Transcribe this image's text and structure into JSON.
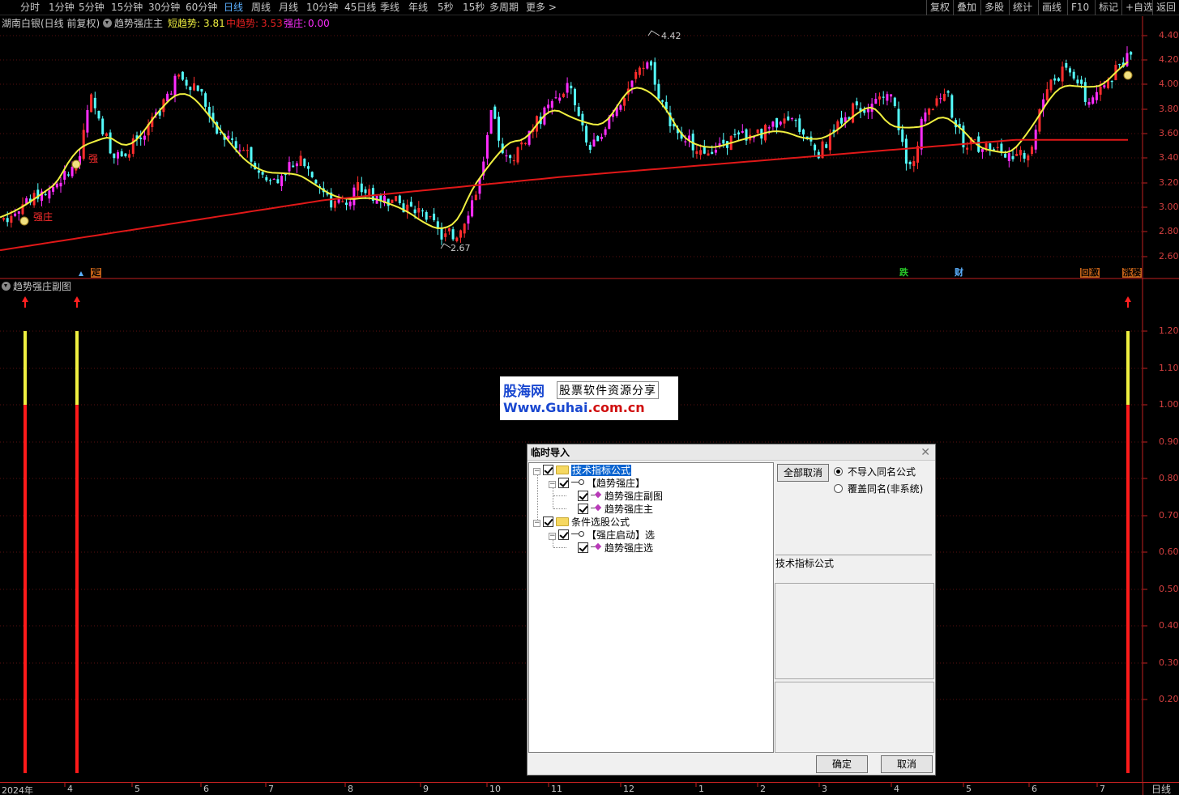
{
  "toolbar": {
    "periods": [
      "分时",
      "1分钟",
      "5分钟",
      "15分钟",
      "30分钟",
      "60分钟",
      "日线",
      "周线",
      "月线",
      "10分钟",
      "45日线",
      "季线",
      "年线",
      "5秒",
      "15秒",
      "多周期",
      "更多 >"
    ],
    "active_period": "日线",
    "right_buttons": [
      "复权",
      "叠加",
      "多股",
      "统计",
      "画线",
      "F10",
      "标记",
      "+自选",
      "返回"
    ]
  },
  "main_chart": {
    "stock_title": "湖南白银(日线 前复权)",
    "indicator_name": "趋势强庄主",
    "short_trend_label": "短趋势:",
    "short_trend_value": "3.81",
    "mid_trend_label": "中趋势:",
    "mid_trend_value": "3.53",
    "strong_label": "强庄:",
    "strong_value": "0.00",
    "high_marker": "4.42",
    "low_marker": "2.67",
    "y_ticks": [
      "4.40",
      "4.20",
      "4.00",
      "3.80",
      "3.60",
      "3.40",
      "3.20",
      "3.00",
      "2.80",
      "2.60"
    ],
    "signal_labels": [
      "强庄",
      "强"
    ],
    "event_markers": [
      "定",
      "跌",
      "财",
      "回激",
      "涨楼"
    ],
    "colors": {
      "up": "#ff2d2d",
      "up_magenta": "#ff2dff",
      "down": "#54fcfc",
      "short_ma": "#f0f040",
      "long_ma": "#e01818"
    }
  },
  "sub_chart": {
    "title": "趋势强庄副图",
    "y_ticks": [
      "1.20",
      "1.10",
      "1.00",
      "0.90",
      "0.80",
      "0.70",
      "0.60",
      "0.50",
      "0.40",
      "0.30",
      "0.20"
    ]
  },
  "date_axis": {
    "labels": [
      "2024年",
      "4",
      "5",
      "6",
      "7",
      "8",
      "9",
      "10",
      "11",
      "12",
      "1",
      "2",
      "3",
      "4",
      "5",
      "6",
      "7"
    ],
    "period": "日线"
  },
  "watermark": {
    "brand": "股海网",
    "slogan": "股票软件资源分享",
    "url_prefix": "Www.",
    "url_name": "Guhai",
    "url_suffix": ".com.cn"
  },
  "dialog": {
    "title": "临时导入",
    "tree": {
      "root1": "技术指标公式",
      "group1": "【趋势强庄】",
      "item1": "趋势强庄副图",
      "item2": "趋势强庄主",
      "root2": "条件选股公式",
      "group2": "【强庄启动】选",
      "item3": "趋势强庄选"
    },
    "cancel_all_button": "全部取消",
    "radio_no_import": "不导入同名公式",
    "radio_overwrite": "覆盖同名(非系统)",
    "info_label": "技术指标公式",
    "ok_button": "确定",
    "cancel_button": "取消"
  }
}
